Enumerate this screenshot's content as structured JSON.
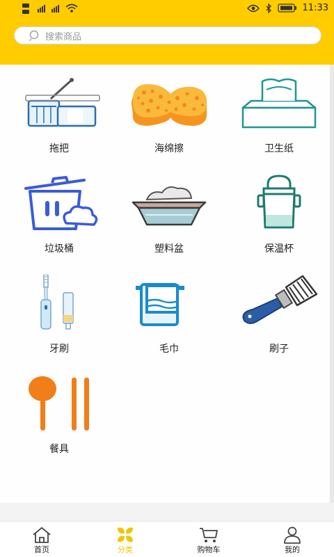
{
  "status": {
    "time": "11:33"
  },
  "search": {
    "placeholder": "搜索商品"
  },
  "categories": [
    {
      "label": "拖把",
      "icon": "mop-bucket-icon"
    },
    {
      "label": "海绵擦",
      "icon": "sponge-icon"
    },
    {
      "label": "卫生纸",
      "icon": "tissue-box-icon"
    },
    {
      "label": "垃圾桶",
      "icon": "trash-bin-icon"
    },
    {
      "label": "塑料盆",
      "icon": "plastic-basin-icon"
    },
    {
      "label": "保温杯",
      "icon": "thermos-cup-icon"
    },
    {
      "label": "牙刷",
      "icon": "toothbrush-icon"
    },
    {
      "label": "毛巾",
      "icon": "towel-icon"
    },
    {
      "label": "刷子",
      "icon": "paint-brush-icon"
    },
    {
      "label": "餐具",
      "icon": "tableware-icon"
    }
  ],
  "nav": [
    {
      "label": "首页",
      "icon": "home-icon"
    },
    {
      "label": "分类",
      "icon": "category-icon",
      "active": true
    },
    {
      "label": "购物车",
      "icon": "cart-icon"
    },
    {
      "label": "我的",
      "icon": "user-icon"
    }
  ],
  "colors": {
    "accent": "#ffcc00",
    "active_tab": "#f4c400"
  }
}
